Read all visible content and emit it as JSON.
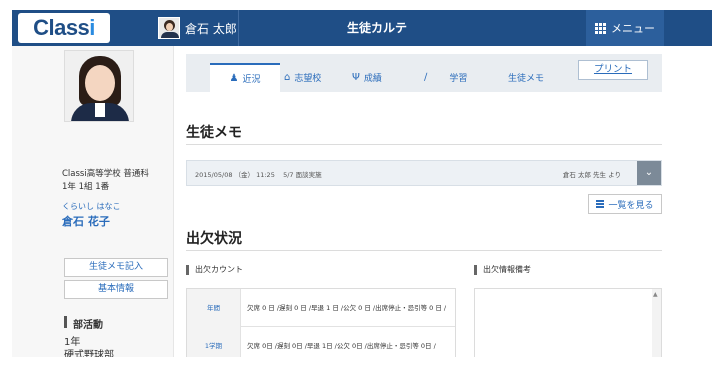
{
  "header": {
    "logo": "Classi",
    "user_name": "倉石 太郎",
    "title": "生徒カルテ",
    "menu_label": "メニュー"
  },
  "student": {
    "school": "Classi高等学校 普通科",
    "class": "1年 1組 1番",
    "kana": "くらいし はなこ",
    "name": "倉石 花子"
  },
  "left_buttons": {
    "memo_entry": "生徒メモ記入",
    "basic_info": "基本情報"
  },
  "club": {
    "title": "部活動",
    "lines": [
      "1年",
      "硬式野球部"
    ]
  },
  "tabs": [
    {
      "label": "近況",
      "icon": "person-icon",
      "active": true
    },
    {
      "label": "志望校",
      "icon": "school-icon",
      "active": false
    },
    {
      "label": "成績",
      "icon": "trophy-icon",
      "active": false
    },
    {
      "label": "学習",
      "icon": "pencil-icon",
      "active": false
    },
    {
      "label": "生徒メモ",
      "icon": "",
      "active": false
    }
  ],
  "print_label": "プリント",
  "memo_section": {
    "title": "生徒メモ",
    "entry": {
      "date": "2015/05/08 （金） 11:25",
      "text": "5/7 面談実施",
      "author": "倉石 太郎 先生 より"
    },
    "list_button": "一覧を見る"
  },
  "attendance": {
    "title": "出欠状況",
    "count_title": "出欠カウント",
    "notes_title": "出欠情報備考",
    "rows": [
      {
        "label": "年間",
        "value": "欠席 0 日 /遅刻 0 日 /早退 1 日 /公欠 0 日 /出席停止・忌引等 0 日 /"
      },
      {
        "label": "1学期",
        "value": "欠席 0日 /遅刻 0日 /早退 1日 /公欠 0日 /出席停止・忌引等 0日 /"
      }
    ]
  }
}
